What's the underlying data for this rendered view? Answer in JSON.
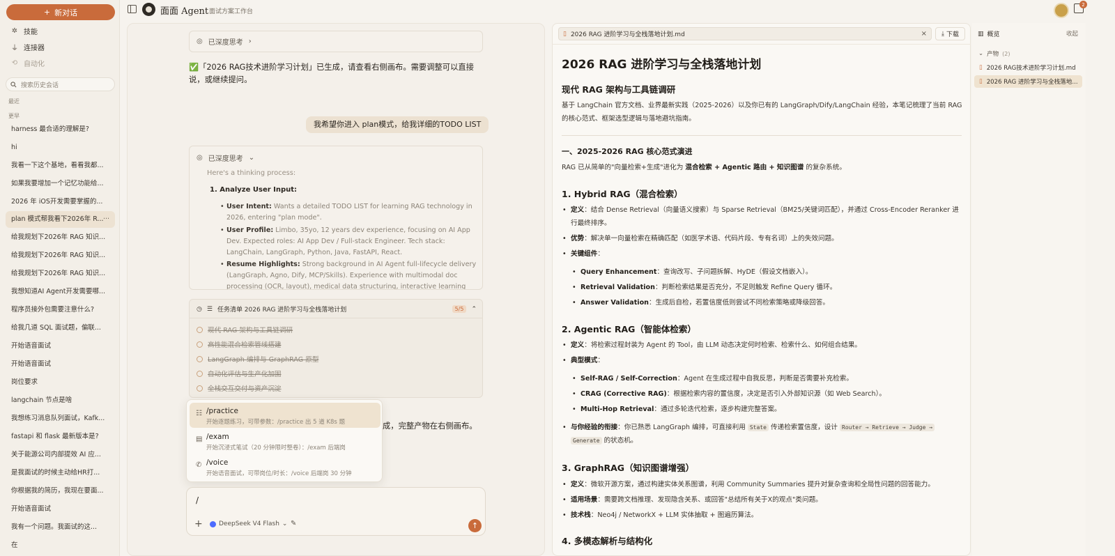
{
  "sidebar": {
    "new_chat": "新对话",
    "nav": [
      {
        "label": "技能",
        "icon": "skills-icon"
      },
      {
        "label": "连接器",
        "icon": "plug-icon"
      },
      {
        "label": "自动化",
        "icon": "automation-icon"
      }
    ],
    "search_placeholder": "搜索历史会话",
    "section_recent": "最近",
    "section_earlier": "更早",
    "history": [
      "harness 最合适的理解是?",
      "hi",
      "我看一下这个基地，看看我都...",
      "如果我要增加一个记忆功能给...",
      "2026 年 iOS开发需要掌握的...",
      "plan 模式帮我看下2026年 R...",
      "给我规划下2026年 RAG 知识...",
      "给我规划下2026年 RAG 知识...",
      "给我规划下2026年 RAG 知识...",
      "我想知道AI Agent开发需要哪...",
      "程序员接外包需要注意什么?",
      "给我几道 SQL 面试题，偏联...",
      "开始语音面试",
      "开始语音面试",
      "岗位要求",
      "langchain 节点是啥",
      "我想练习消息队列面试，Kafk...",
      "fastapi 和 flask 最新版本是?",
      "关于能源公司内部提效 AI 应...",
      "是我面试的时候主动给HR打...",
      "你根据我的简历，我现在要面...",
      "开始语音面试",
      "我有一个问题。我面试的这...",
      "在"
    ],
    "active_more": "···"
  },
  "header": {
    "brand": "面面 Agent",
    "subtitle": "面试方案工作台",
    "notif_count": "2"
  },
  "chat": {
    "think_collapsed": "已深度思考",
    "assistant_msg": "✅「2026 RAG技术进阶学习计划」已生成，请查看右侧画布。需要调整可以直接说，或继续提问。",
    "user_msg": "我希望你进入 plan模式，给我详细的TODO LIST",
    "think_open": "已深度思考",
    "think_intro": "Here's a thinking process:",
    "think_step": "1. Analyze User Input:",
    "think_bullets": [
      {
        "k": "User Intent:",
        "v": " Wants a detailed TODO LIST for learning RAG technology in 2026, entering \"plan mode\"."
      },
      {
        "k": "User Profile:",
        "v": " Limbo, 35yo, 12 years dev experience, focusing on AI App Dev. Expected roles: AI App Dev / Full-stack Engineer. Tech stack: LangChain, LangGraph, Python, Java, FastAPI, React."
      },
      {
        "k": "Resume Highlights:",
        "v": " Strong background in AI Agent full-lifecycle delivery (LangGraph, Agno, Dify, MCP/Skills). Experience with multimodal doc processing (OCR, layout), medical data structuring, interactive learning apps, ticket"
      }
    ],
    "task_title": "任务清单  2026 RAG 进阶学习与全栈落地计划",
    "task_count": "5/5",
    "tasks": [
      "现代 RAG 架构与工具链调研",
      "高性能混合检索管线搭建",
      "LangGraph 编排与 GraphRAG 原型",
      "自动化评估与生产化加固",
      "全栈交互交付与资产沉淀"
    ],
    "tail_text": "成，完整产物在右侧画布。",
    "commands": [
      {
        "name": "/practice",
        "desc": "开始逐题练习，可带参数：/practice 出 5 道 K8s 题",
        "icon": "list-icon"
      },
      {
        "name": "/exam",
        "desc": "开始沉浸式笔试（20 分钟限时整卷）：/exam 后端岗",
        "icon": "clipboard-icon"
      },
      {
        "name": "/voice",
        "desc": "开始语音面试，可带岗位/时长：/voice 后端岗 30 分钟",
        "icon": "phone-icon"
      }
    ],
    "composer_value": "/",
    "model": "DeepSeek V4 Flash"
  },
  "doc": {
    "tab_title": "2026 RAG 进阶学习与全栈落地计划.md",
    "download": "下载",
    "h1": "2026 RAG 进阶学习与全栈落地计划",
    "h2_intro": "现代 RAG 架构与工具链调研",
    "intro": "基于 LangChain 官方文档、业界最新实践（2025-2026）以及你已有的 LangGraph/Dify/LangChain 经验，本笔记梳理了当前 RAG 的核心范式、框架选型逻辑与落地避坑指南。",
    "sec1": "一、2025-2026 RAG 核心范式演进",
    "sec1_p_pre": "RAG 已从简单的\"向量检索+生成\"进化为 ",
    "sec1_p_bold": "混合检索 + Agentic 路由 + 知识图谱",
    "sec1_p_post": " 的复杂系统。",
    "h_hybrid": "1. Hybrid RAG（混合检索）",
    "hy_def_k": "定义",
    "hy_def": "：结合 Dense Retrieval（向量语义搜索）与 Sparse Retrieval（BM25/关键词匹配），并通过 Cross-Encoder Reranker 进行最终排序。",
    "hy_adv_k": "优势",
    "hy_adv": "：解决单一向量检索在精确匹配（如医学术语、代码片段、专有名词）上的失效问题。",
    "hy_comp_k": "关键组件",
    "hy_comp": "：",
    "hy_sub": [
      {
        "k": "Query Enhancement",
        "v": "：查询改写、子问题拆解、HyDE（假设文档嵌入）。"
      },
      {
        "k": "Retrieval Validation",
        "v": "：判断检索结果是否充分，不足则触发 Refine Query 循环。"
      },
      {
        "k": "Answer Validation",
        "v": "：生成后自检，若置信度低则尝试不同检索策略或降级回答。"
      }
    ],
    "h_agentic": "2. Agentic RAG（智能体检索）",
    "ag_def_k": "定义",
    "ag_def": "：将检索过程封装为 Agent 的 Tool，由 LLM 动态决定何时检索、检索什么、如何组合结果。",
    "ag_mode_k": "典型模式",
    "ag_mode": "：",
    "ag_sub": [
      {
        "k": "Self-RAG / Self-Correction",
        "v": "：Agent 在生成过程中自我反思，判断是否需要补充检索。"
      },
      {
        "k": "CRAG (Corrective RAG)",
        "v": "：根据检索内容的置信度，决定是否引入外部知识源（如 Web Search）。"
      },
      {
        "k": "Multi-Hop Retrieval",
        "v": "：通过多轮迭代检索，逐步构建完整答案。"
      }
    ],
    "ag_exp_k": "与你经验的衔接",
    "ag_exp_1": "：你已熟悉 LangGraph 编排，可直接利用 ",
    "ag_exp_code1": "State",
    "ag_exp_2": " 传递检索置信度，设计 ",
    "ag_exp_code2": "Router → Retrieve → Judge →",
    "ag_exp_code3": "Generate",
    "ag_exp_3": " 的状态机。",
    "h_graph": "3. GraphRAG（知识图谱增强）",
    "gr_def_k": "定义",
    "gr_def": "：微软开源方案，通过构建实体关系图谱，利用 Community Summaries 提升对复杂查询和全局性问题的回答能力。",
    "gr_use_k": "适用场景",
    "gr_use": "：需要跨文档推理、发现隐含关系、或回答\"总结所有关于X的观点\"类问题。",
    "gr_stack_k": "技术栈",
    "gr_stack": "：Neo4j / NetworkX + LLM 实体抽取 + 图遍历算法。",
    "h_multi": "4. 多模态解析与结构化"
  },
  "overview": {
    "title": "概览",
    "collapse": "收起",
    "group": "产物",
    "group_count": "(2)",
    "items": [
      "2026 RAG技术进阶学习计划.md",
      "2026 RAG 进阶学习与全栈落地..."
    ]
  }
}
